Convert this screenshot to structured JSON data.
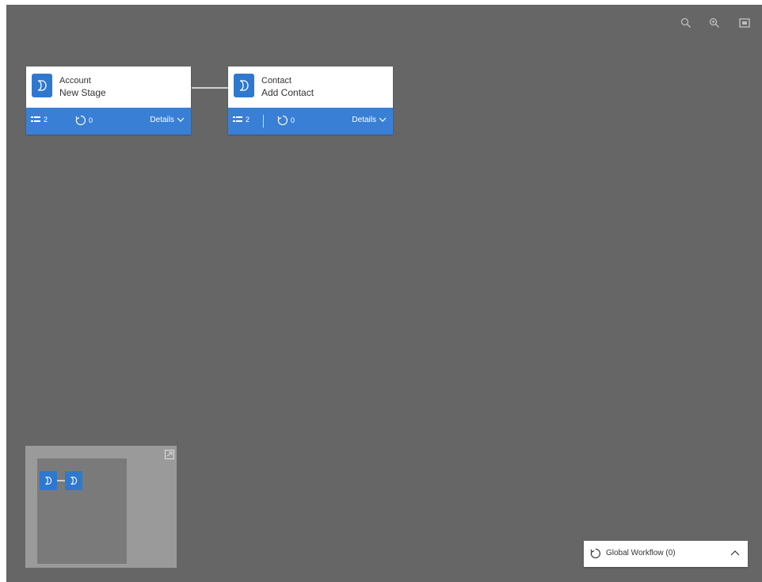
{
  "toolbar": {
    "zoom_out_icon": "zoom-out-icon",
    "zoom_in_icon": "zoom-in-icon",
    "fit_icon": "fit-to-screen-icon"
  },
  "stages": [
    {
      "entity": "Account",
      "name": "New Stage",
      "steps_count": "2",
      "workflows_count": "0",
      "details_label": "Details"
    },
    {
      "entity": "Contact",
      "name": "Add Contact",
      "steps_count": "2",
      "workflows_count": "0",
      "details_label": "Details"
    }
  ],
  "global_workflow": {
    "label": "Global Workflow (0)"
  },
  "colors": {
    "canvas": "#666666",
    "accent": "#3a7fd6",
    "minimap": "#9a9a9a"
  }
}
